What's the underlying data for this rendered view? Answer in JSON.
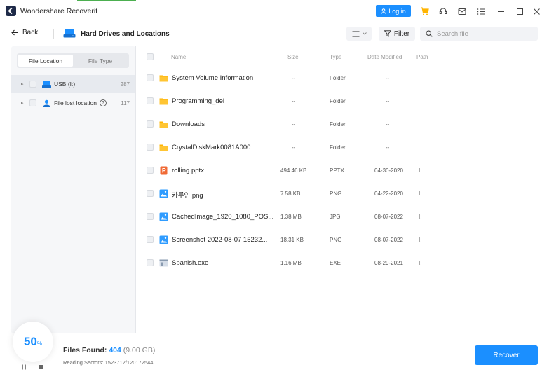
{
  "app": {
    "title": "Wondershare Recoverit"
  },
  "titlebar": {
    "login_label": "Log in"
  },
  "toolbar": {
    "back_label": "Back",
    "location_title": "Hard Drives and Locations",
    "filter_label": "Filter",
    "search_placeholder": "Search file"
  },
  "sidebar": {
    "tabs": [
      {
        "label": "File Location",
        "active": true
      },
      {
        "label": "File Type",
        "active": false
      }
    ],
    "items": [
      {
        "label": "USB (I:)",
        "count": "287",
        "icon": "usb-drive-icon",
        "selected": true
      },
      {
        "label": "File lost location",
        "count": "117",
        "icon": "user-location-icon",
        "selected": false
      }
    ]
  },
  "table": {
    "headers": {
      "name": "Name",
      "size": "Size",
      "type": "Type",
      "date": "Date Modified",
      "path": "Path"
    },
    "rows": [
      {
        "name": "System Volume Information",
        "size": "--",
        "type": "Folder",
        "date": "--",
        "path": "",
        "icon": "folder-icon"
      },
      {
        "name": "Programming_del",
        "size": "--",
        "type": "Folder",
        "date": "--",
        "path": "",
        "icon": "folder-icon"
      },
      {
        "name": "Downloads",
        "size": "--",
        "type": "Folder",
        "date": "--",
        "path": "",
        "icon": "folder-icon"
      },
      {
        "name": "CrystalDiskMark0081A000",
        "size": "--",
        "type": "Folder",
        "date": "--",
        "path": "",
        "icon": "folder-icon"
      },
      {
        "name": "rolling.pptx",
        "size": "494.46 KB",
        "type": "PPTX",
        "date": "04-30-2020",
        "path": "I:",
        "icon": "pptx-icon"
      },
      {
        "name": "카루인.png",
        "size": "7.58 KB",
        "type": "PNG",
        "date": "04-22-2020",
        "path": "I:",
        "icon": "image-icon"
      },
      {
        "name": "CachedImage_1920_1080_POS...",
        "size": "1.38 MB",
        "type": "JPG",
        "date": "08-07-2022",
        "path": "I:",
        "icon": "image-icon"
      },
      {
        "name": "Screenshot 2022-08-07 15232...",
        "size": "18.31 KB",
        "type": "PNG",
        "date": "08-07-2022",
        "path": "I:",
        "icon": "image-icon"
      },
      {
        "name": "Spanish.exe",
        "size": "1.16 MB",
        "type": "EXE",
        "date": "08-29-2021",
        "path": "I:",
        "icon": "exe-icon"
      }
    ]
  },
  "status": {
    "progress": "50",
    "progress_unit": "%",
    "files_found_label": "Files Found:",
    "files_found_count": "404",
    "files_found_size": "(9.00 GB)",
    "sectors": "Reading Sectors: 1523712/120172544",
    "recover_label": "Recover"
  },
  "colors": {
    "accent": "#1b8fff",
    "folder": "#ffb400",
    "pptx": "#f06a35",
    "image": "#2f9cff",
    "exe": "#8a9bb0"
  }
}
